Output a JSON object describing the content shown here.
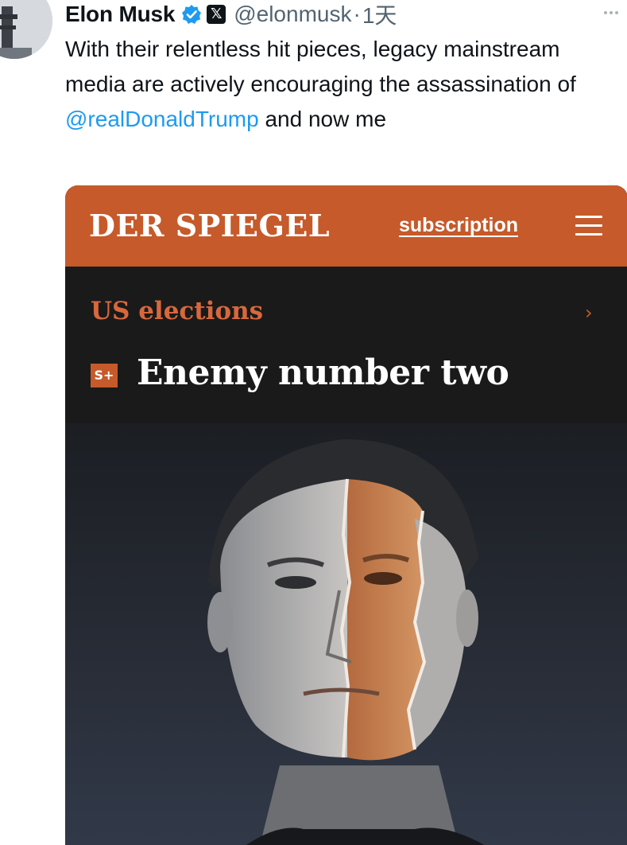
{
  "tweet": {
    "author_name": "Elon Musk",
    "handle": "@elonmusk",
    "separator": "·",
    "time": "1天",
    "text_before": "With their relentless hit pieces, legacy mainstream media are actively  encouraging the assassination of ",
    "mention": "@realDonaldTrump",
    "text_after": " and now me"
  },
  "icons": {
    "verified": "verified-badge-icon",
    "x_logo": "x-logo-icon",
    "more": "more-options-icon"
  },
  "media": {
    "logo": "DER SPIEGEL",
    "subscription": "subscription",
    "section": "US elections",
    "chevron": "›",
    "badge": "S+",
    "headline": "Enemy number two"
  },
  "colors": {
    "spiegel_orange": "#c65a2b",
    "mention_blue": "#1d9bf0",
    "verified_blue": "#1d9bf0"
  }
}
